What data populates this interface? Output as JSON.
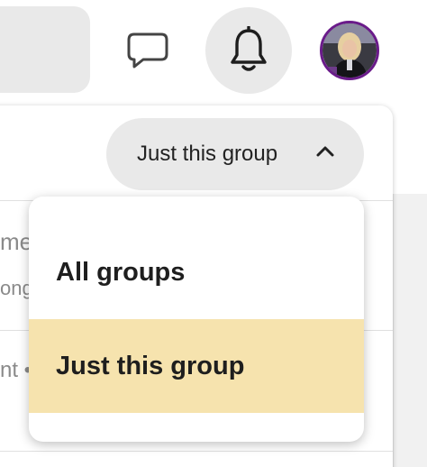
{
  "header": {
    "messages_icon": "chat-bubble-icon",
    "notifications_icon": "bell-icon",
    "avatar_alt": "user-avatar"
  },
  "background_fragments": {
    "line1": "me",
    "line2": "ong",
    "line3": "nt •"
  },
  "filter": {
    "selected_label": "Just this group",
    "chevron": "chevron-up-icon"
  },
  "dropdown": {
    "options": [
      {
        "label": "All groups",
        "selected": false
      },
      {
        "label": "Just this group",
        "selected": true
      }
    ],
    "highlight_color": "#f6e3ae"
  }
}
